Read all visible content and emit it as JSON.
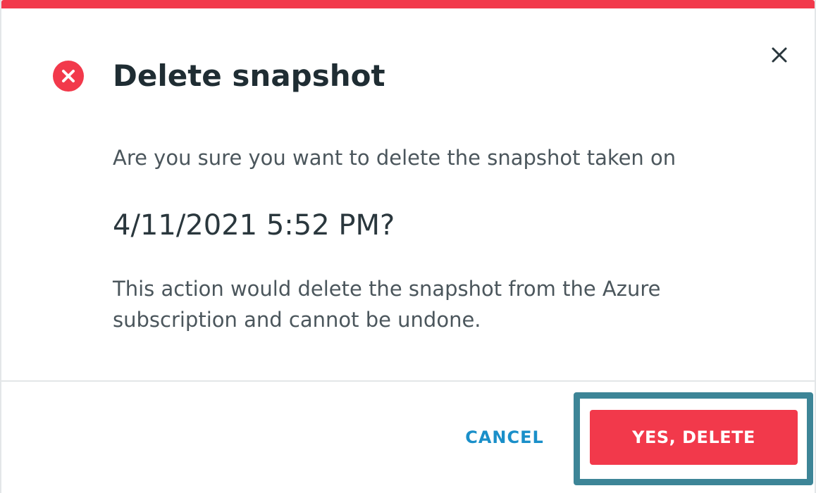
{
  "dialog": {
    "title": "Delete snapshot",
    "question": "Are you sure you want to delete the snapshot taken on",
    "timestamp": "4/11/2021 5:52 PM?",
    "warning": "This action would delete the snapshot from the Azure subscription and cannot be undone.",
    "accent_color": "#f2394b",
    "icons": {
      "status": "error-circle-x-icon",
      "close": "close-icon"
    }
  },
  "footer": {
    "cancel_label": "CANCEL",
    "delete_label": "YES, DELETE",
    "cancel_color": "#1a8fc9",
    "focus_ring_color": "#3d8597"
  }
}
